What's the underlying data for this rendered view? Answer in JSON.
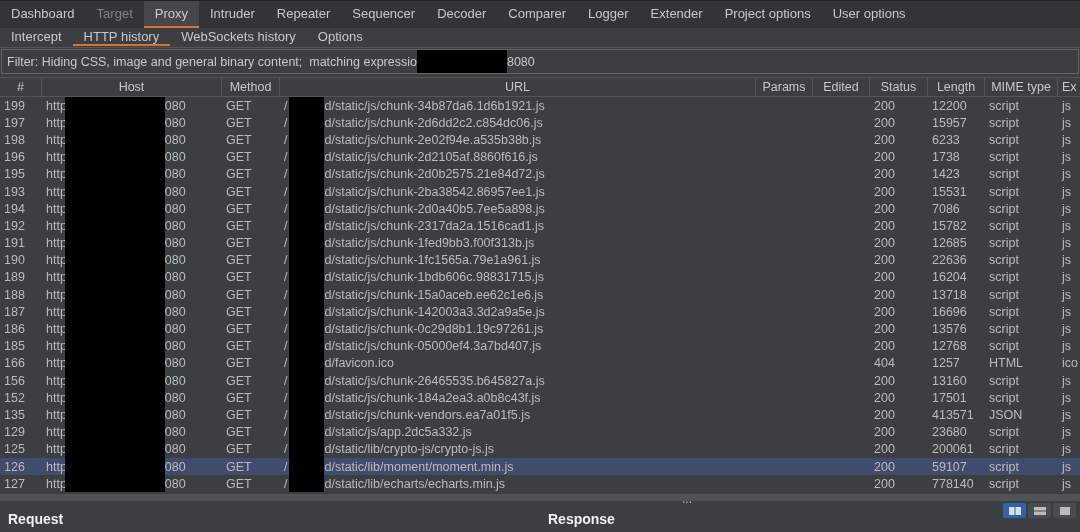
{
  "main_tabs": [
    {
      "label": "Dashboard",
      "selected": false,
      "disabled": false
    },
    {
      "label": "Target",
      "selected": false,
      "disabled": true
    },
    {
      "label": "Proxy",
      "selected": true,
      "disabled": false
    },
    {
      "label": "Intruder",
      "selected": false,
      "disabled": false
    },
    {
      "label": "Repeater",
      "selected": false,
      "disabled": false
    },
    {
      "label": "Sequencer",
      "selected": false,
      "disabled": false
    },
    {
      "label": "Decoder",
      "selected": false,
      "disabled": false
    },
    {
      "label": "Comparer",
      "selected": false,
      "disabled": false
    },
    {
      "label": "Logger",
      "selected": false,
      "disabled": false
    },
    {
      "label": "Extender",
      "selected": false,
      "disabled": false
    },
    {
      "label": "Project options",
      "selected": false,
      "disabled": false
    },
    {
      "label": "User options",
      "selected": false,
      "disabled": false
    }
  ],
  "sub_tabs": [
    {
      "label": "Intercept",
      "selected": false
    },
    {
      "label": "HTTP history",
      "selected": true
    },
    {
      "label": "WebSockets history",
      "selected": false
    },
    {
      "label": "Options",
      "selected": false
    }
  ],
  "filter": {
    "text_before": "Filter: Hiding CSS, image and general binary content;  matching expressio",
    "text_after": "8080"
  },
  "table": {
    "columns": [
      "#",
      "Host",
      "Method",
      "URL",
      "Params",
      "Edited",
      "Status",
      "Length",
      "MIME type",
      "Ex"
    ],
    "rows": [
      {
        "number": "199",
        "host_start": "http",
        "host_end": "080",
        "method": "GET",
        "url_start": "/",
        "url_end": "d/static/js/chunk-34b87da6.1d6b1921.js",
        "status": "200",
        "length": "12200",
        "mime": "script",
        "ext": "js",
        "selected": false
      },
      {
        "number": "197",
        "host_start": "http",
        "host_end": "080",
        "method": "GET",
        "url_start": "/",
        "url_end": "d/static/js/chunk-2d6dd2c2.c854dc06.js",
        "status": "200",
        "length": "15957",
        "mime": "script",
        "ext": "js",
        "selected": false
      },
      {
        "number": "198",
        "host_start": "http",
        "host_end": "080",
        "method": "GET",
        "url_start": "/",
        "url_end": "d/static/js/chunk-2e02f94e.a535b38b.js",
        "status": "200",
        "length": "6233",
        "mime": "script",
        "ext": "js",
        "selected": false
      },
      {
        "number": "196",
        "host_start": "http",
        "host_end": "080",
        "method": "GET",
        "url_start": "/",
        "url_end": "d/static/js/chunk-2d2105af.8860f616.js",
        "status": "200",
        "length": "1738",
        "mime": "script",
        "ext": "js",
        "selected": false
      },
      {
        "number": "195",
        "host_start": "http",
        "host_end": "080",
        "method": "GET",
        "url_start": "/",
        "url_end": "d/static/js/chunk-2d0b2575.21e84d72.js",
        "status": "200",
        "length": "1423",
        "mime": "script",
        "ext": "js",
        "selected": false
      },
      {
        "number": "193",
        "host_start": "http",
        "host_end": "080",
        "method": "GET",
        "url_start": "/",
        "url_end": "d/static/js/chunk-2ba38542.86957ee1.js",
        "status": "200",
        "length": "15531",
        "mime": "script",
        "ext": "js",
        "selected": false
      },
      {
        "number": "194",
        "host_start": "http",
        "host_end": "080",
        "method": "GET",
        "url_start": "/",
        "url_end": "d/static/js/chunk-2d0a40b5.7ee5a898.js",
        "status": "200",
        "length": "7086",
        "mime": "script",
        "ext": "js",
        "selected": false
      },
      {
        "number": "192",
        "host_start": "http",
        "host_end": "080",
        "method": "GET",
        "url_start": "/",
        "url_end": "d/static/js/chunk-2317da2a.1516cad1.js",
        "status": "200",
        "length": "15782",
        "mime": "script",
        "ext": "js",
        "selected": false
      },
      {
        "number": "191",
        "host_start": "http",
        "host_end": "080",
        "method": "GET",
        "url_start": "/",
        "url_end": "d/static/js/chunk-1fed9bb3.f00f313b.js",
        "status": "200",
        "length": "12685",
        "mime": "script",
        "ext": "js",
        "selected": false
      },
      {
        "number": "190",
        "host_start": "http",
        "host_end": "080",
        "method": "GET",
        "url_start": "/",
        "url_end": "d/static/js/chunk-1fc1565a.79e1a961.js",
        "status": "200",
        "length": "22636",
        "mime": "script",
        "ext": "js",
        "selected": false
      },
      {
        "number": "189",
        "host_start": "http",
        "host_end": "080",
        "method": "GET",
        "url_start": "/",
        "url_end": "d/static/js/chunk-1bdb606c.98831715.js",
        "status": "200",
        "length": "16204",
        "mime": "script",
        "ext": "js",
        "selected": false
      },
      {
        "number": "188",
        "host_start": "http",
        "host_end": "080",
        "method": "GET",
        "url_start": "/",
        "url_end": "d/static/js/chunk-15a0aceb.ee62c1e6.js",
        "status": "200",
        "length": "13718",
        "mime": "script",
        "ext": "js",
        "selected": false
      },
      {
        "number": "187",
        "host_start": "http",
        "host_end": "080",
        "method": "GET",
        "url_start": "/",
        "url_end": "d/static/js/chunk-142003a3.3d2a9a5e.js",
        "status": "200",
        "length": "16696",
        "mime": "script",
        "ext": "js",
        "selected": false
      },
      {
        "number": "186",
        "host_start": "http",
        "host_end": "080",
        "method": "GET",
        "url_start": "/",
        "url_end": "d/static/js/chunk-0c29d8b1.19c97261.js",
        "status": "200",
        "length": "13576",
        "mime": "script",
        "ext": "js",
        "selected": false
      },
      {
        "number": "185",
        "host_start": "http",
        "host_end": "080",
        "method": "GET",
        "url_start": "/",
        "url_end": "d/static/js/chunk-05000ef4.3a7bd407.js",
        "status": "200",
        "length": "12768",
        "mime": "script",
        "ext": "js",
        "selected": false
      },
      {
        "number": "166",
        "host_start": "http",
        "host_end": "080",
        "method": "GET",
        "url_start": "/",
        "url_end": "d/favicon.ico",
        "status": "404",
        "length": "1257",
        "mime": "HTML",
        "ext": "ico",
        "selected": false
      },
      {
        "number": "156",
        "host_start": "http",
        "host_end": "080",
        "method": "GET",
        "url_start": "/",
        "url_end": "d/static/js/chunk-26465535.b645827a.js",
        "status": "200",
        "length": "13160",
        "mime": "script",
        "ext": "js",
        "selected": false
      },
      {
        "number": "152",
        "host_start": "http",
        "host_end": "080",
        "method": "GET",
        "url_start": "/",
        "url_end": "d/static/js/chunk-184a2ea3.a0b8c43f.js",
        "status": "200",
        "length": "17501",
        "mime": "script",
        "ext": "js",
        "selected": false
      },
      {
        "number": "135",
        "host_start": "http",
        "host_end": "080",
        "method": "GET",
        "url_start": "/",
        "url_end": "d/static/js/chunk-vendors.ea7a01f5.js",
        "status": "200",
        "length": "413571",
        "mime": "JSON",
        "ext": "js",
        "selected": false
      },
      {
        "number": "129",
        "host_start": "http",
        "host_end": "080",
        "method": "GET",
        "url_start": "/",
        "url_end": "d/static/js/app.2dc5a332.js",
        "status": "200",
        "length": "23680",
        "mime": "script",
        "ext": "js",
        "selected": false
      },
      {
        "number": "125",
        "host_start": "http",
        "host_end": "080",
        "method": "GET",
        "url_start": "/",
        "url_end": "d/static/lib/crypto-js/crypto-js.js",
        "status": "200",
        "length": "200061",
        "mime": "script",
        "ext": "js",
        "selected": false
      },
      {
        "number": "126",
        "host_start": "http",
        "host_end": "080",
        "method": "GET",
        "url_start": "/",
        "url_end": "d/static/lib/moment/moment.min.js",
        "status": "200",
        "length": "59107",
        "mime": "script",
        "ext": "js",
        "selected": true
      },
      {
        "number": "127",
        "host_start": "http",
        "host_end": "080",
        "method": "GET",
        "url_start": "/",
        "url_end": "d/static/lib/echarts/echarts.min.js",
        "status": "200",
        "length": "778140",
        "mime": "script",
        "ext": "js",
        "selected": false
      }
    ]
  },
  "splitter_handle": "...",
  "request_pane": {
    "title": "Request"
  },
  "response_pane": {
    "title": "Response"
  },
  "layout_buttons": [
    {
      "kind": "columns",
      "selected": true
    },
    {
      "kind": "rows",
      "selected": false
    },
    {
      "kind": "single",
      "selected": false
    }
  ]
}
